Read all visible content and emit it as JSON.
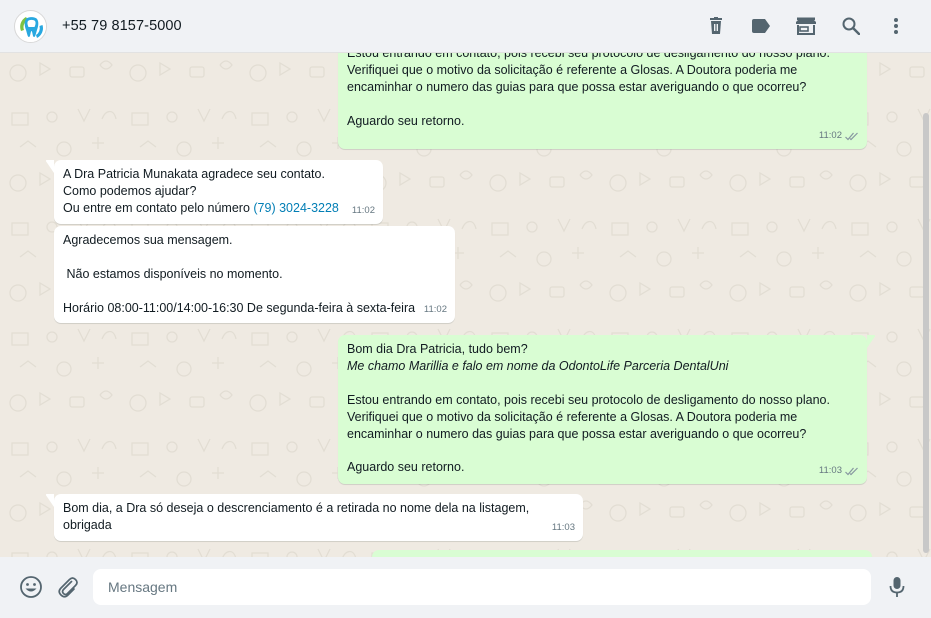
{
  "header": {
    "contact_name": "+55 79 8157-5000",
    "avatar_icon": "tooth-logo-icon",
    "actions": [
      "trash-icon",
      "label-icon",
      "store-icon",
      "search-icon",
      "more-vertical-icon"
    ]
  },
  "messages": [
    {
      "direction": "out",
      "lines": [
        {
          "text": "Estou entrando em contato, pois recebi seu protocolo de desligamento do nosso plano."
        },
        {
          "text": "Verifiquei que o motivo da solicitação é referente a Glosas. A Doutora poderia me"
        },
        {
          "text": "encaminhar o numero das guias para que possa estar averiguando o que ocorreu?"
        },
        {
          "text": ""
        },
        {
          "text": "Aguardo seu retorno."
        }
      ],
      "time": "11:02",
      "status": "read"
    },
    {
      "direction": "in",
      "lines": [
        {
          "text": "A Dra Patricia Munakata agradece seu contato."
        },
        {
          "text": "Como podemos ajudar?"
        },
        {
          "text": "Ou entre em contato pelo número ",
          "link": "(79) 3024-3228"
        }
      ],
      "time": "11:02"
    },
    {
      "direction": "in",
      "lines": [
        {
          "text": "Agradecemos sua mensagem."
        },
        {
          "text": ""
        },
        {
          "text": " Não estamos disponíveis no momento."
        },
        {
          "text": ""
        },
        {
          "text": "Horário 08:00-11:00/14:00-16:30 De segunda-feira à sexta-feira"
        }
      ],
      "time": "11:02"
    },
    {
      "direction": "out",
      "lines": [
        {
          "text": "Bom dia Dra Patricia, tudo bem?"
        },
        {
          "text": "Me chamo Marillia e falo em nome da OdontoLife Parceria DentalUni",
          "italic": true
        },
        {
          "text": ""
        },
        {
          "text": "Estou entrando em contato, pois recebi seu protocolo de desligamento do nosso plano."
        },
        {
          "text": "Verifiquei que o motivo da solicitação é referente a Glosas. A Doutora poderia me"
        },
        {
          "text": "encaminhar o numero das guias para que possa estar averiguando o que ocorreu?"
        },
        {
          "text": ""
        },
        {
          "text": "Aguardo seu retorno."
        }
      ],
      "time": "11:03",
      "status": "read"
    },
    {
      "direction": "in",
      "lines": [
        {
          "text": "Bom dia, a Dra só deseja o descrenciamento é a retirada no nome dela na listagem,"
        },
        {
          "text": "obrigada"
        }
      ],
      "time": "11:03"
    }
  ],
  "composer": {
    "placeholder": "Mensagem",
    "value": "",
    "left_icons": [
      "emoji-icon",
      "attach-icon"
    ],
    "right_icon": "microphone-icon"
  },
  "colors": {
    "header_bg": "#f0f2f5",
    "chat_bg": "#efeae2",
    "bubble_in": "#ffffff",
    "bubble_out": "#d9fdd3",
    "link": "#027eb5",
    "read_ticks": "#8696a0"
  }
}
